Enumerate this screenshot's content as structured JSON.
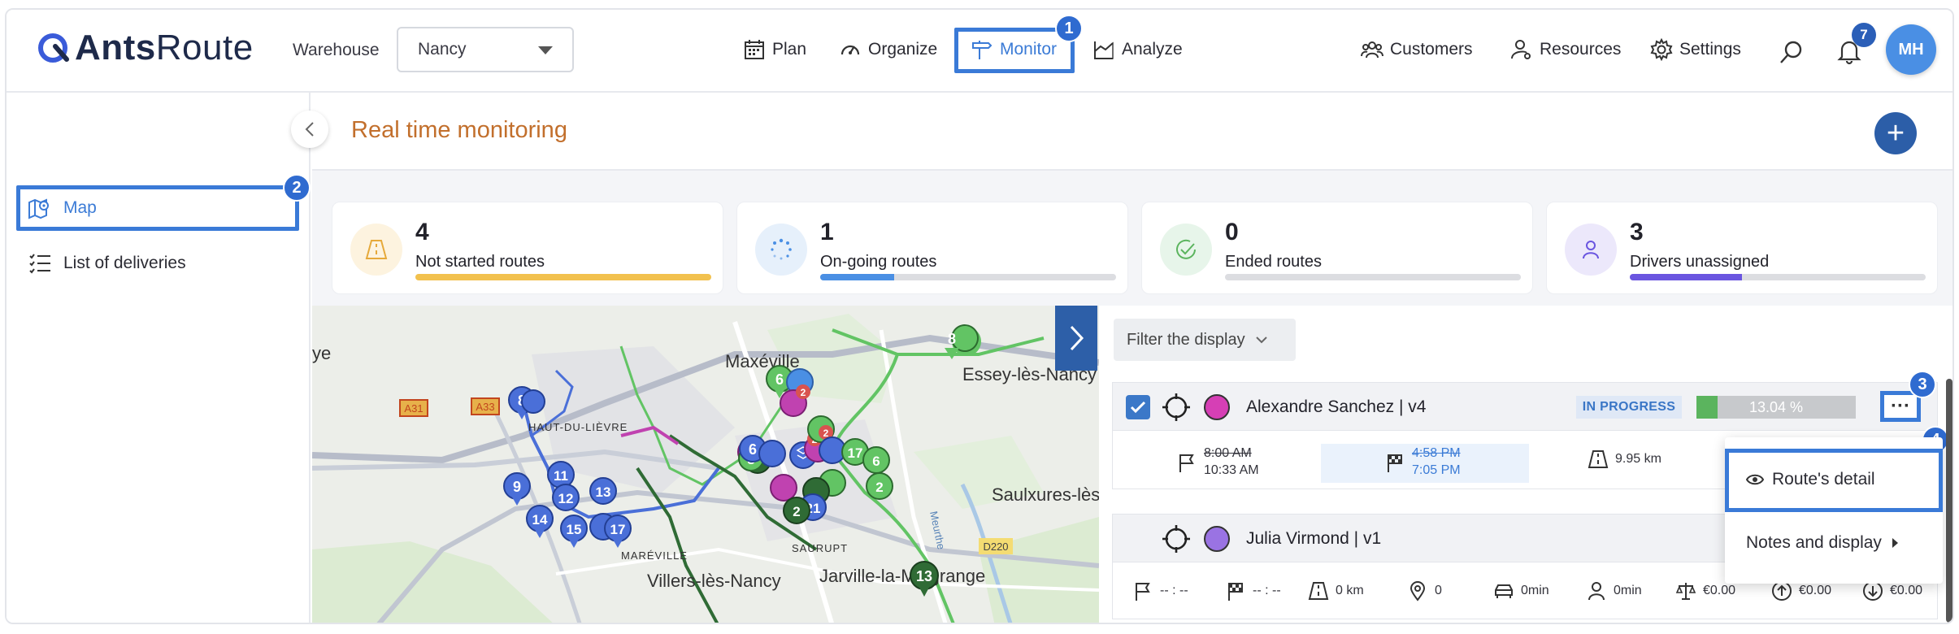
{
  "header": {
    "logo_bold": "Ants",
    "logo_light": "Route",
    "warehouse_label": "Warehouse",
    "warehouse_value": "Nancy",
    "nav": {
      "plan": "Plan",
      "organize": "Organize",
      "monitor": "Monitor",
      "analyze": "Analyze",
      "customers": "Customers",
      "resources": "Resources",
      "settings": "Settings"
    },
    "notifications_count": "7",
    "avatar_initials": "MH"
  },
  "annotations": {
    "n1": "1",
    "n2": "2",
    "n3": "3",
    "n4": "4"
  },
  "sidebar": {
    "items": [
      {
        "label": "Map",
        "active": true,
        "icon": "map-icon"
      },
      {
        "label": "List of deliveries",
        "active": false,
        "icon": "list-icon"
      }
    ]
  },
  "page": {
    "title": "Real time monitoring"
  },
  "stats": [
    {
      "value": "4",
      "label": "Not started routes",
      "fraction": 1.0,
      "color": "#f2c14e",
      "icon_bg": "#fdf3df",
      "icon": "road-icon"
    },
    {
      "value": "1",
      "label": "On-going routes",
      "fraction": 0.25,
      "color": "#4a8fe4",
      "icon_bg": "#e6f0fb",
      "icon": "spinner-icon"
    },
    {
      "value": "0",
      "label": "Ended routes",
      "fraction": 0.0,
      "color": "#5bb45e",
      "icon_bg": "#e7f5ea",
      "icon": "check-circle-icon"
    },
    {
      "value": "3",
      "label": "Drivers unassigned",
      "fraction": 0.38,
      "color": "#6a55e0",
      "icon_bg": "#ece8fb",
      "icon": "person-icon"
    }
  ],
  "map": {
    "places": {
      "maxeville": "Maxéville",
      "essey": "Essey-lès-Nancy",
      "haut_du_lievre": "HAUT-DU-LIÈVRE",
      "saulxures": "Saulxures-lès",
      "mareville": "MARÉVILLE",
      "villers": "Villers-lès-Nancy",
      "saurupt": "SAURUPT",
      "jarville": "Jarville-la-Malgrange",
      "meurthe": "Meurthe",
      "ye": "ye"
    },
    "roads": {
      "a31": "A31",
      "a33": "A33",
      "d220": "D220"
    },
    "pins": {
      "p8a": "8",
      "p6": "6",
      "p2a": "2",
      "p9": "9",
      "p11": "11",
      "p12": "12",
      "p13": "13",
      "p14": "14",
      "p15": "15",
      "p17": "17",
      "p6b": "6",
      "p2b": "2",
      "p8b": "8",
      "p2c": "2",
      "p17b": "17",
      "p6c": "6",
      "p2d": "2",
      "p21": "21",
      "p2e": "2",
      "p13b": "13",
      "p8c": "8"
    }
  },
  "panel": {
    "filter_label": "Filter the display",
    "routes": [
      {
        "name": "Alexandre Sanchez | v4",
        "color": "#d63fb5",
        "status": "IN PROGRESS",
        "progress_label": "13.04 %",
        "progress": 0.1304,
        "start_planned": "8:00 AM",
        "start_actual": "10:33 AM",
        "end_planned": "4:58 PM",
        "end_actual": "7:05 PM",
        "distance": "9.95 km",
        "more": "···"
      },
      {
        "name": "Julia Virmond | v1",
        "color": "#9a73e3",
        "start": "-- : --",
        "end": "-- : --",
        "distance": "0 km",
        "stops": "0",
        "drive_time": "0min",
        "work_time": "0min",
        "cost": "€0.00",
        "revenue": "€0.00",
        "expense": "€0.00"
      }
    ],
    "menu": {
      "route_detail": "Route's detail",
      "notes_display": "Notes and display"
    }
  }
}
